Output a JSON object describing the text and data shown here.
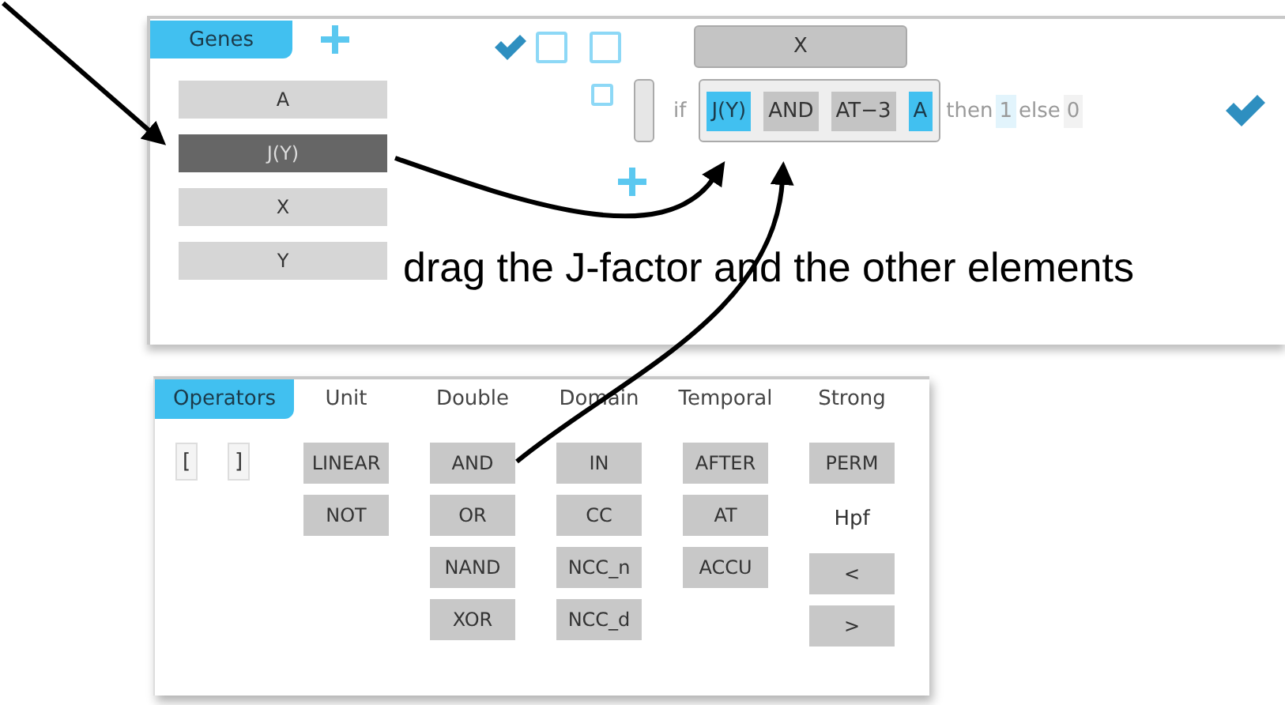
{
  "genes_panel": {
    "tab": {
      "label": "Genes",
      "selected": true
    },
    "genes": [
      {
        "label": "A",
        "selected": false
      },
      {
        "label": "J(Y)",
        "selected": true
      },
      {
        "label": "X",
        "selected": false
      },
      {
        "label": "Y",
        "selected": false
      }
    ],
    "column_checkboxes": [
      {
        "checked": false
      },
      {
        "checked": false
      }
    ],
    "rule": {
      "target": "X",
      "row_checked": false,
      "if_label": "if",
      "tokens": [
        {
          "label": "J(Y)",
          "kind": "gene"
        },
        {
          "label": "AND",
          "kind": "operator"
        },
        {
          "label": "AT−3",
          "kind": "operator"
        },
        {
          "label": "A",
          "kind": "gene"
        }
      ],
      "then_label": "then",
      "then_value": "1",
      "else_label": "else",
      "else_value": "0"
    }
  },
  "caption": "drag the J-factor and the other elements",
  "operators_panel": {
    "tab": {
      "label": "Operators",
      "selected": true
    },
    "brackets": [
      "[",
      "]"
    ],
    "columns": [
      {
        "header": "Unit",
        "items": [
          {
            "label": "LINEAR",
            "kind": "button"
          },
          {
            "label": "NOT",
            "kind": "button"
          }
        ]
      },
      {
        "header": "Double",
        "items": [
          {
            "label": "AND",
            "kind": "button"
          },
          {
            "label": "OR",
            "kind": "button"
          },
          {
            "label": "NAND",
            "kind": "button"
          },
          {
            "label": "XOR",
            "kind": "button"
          }
        ]
      },
      {
        "header": "Domain",
        "items": [
          {
            "label": "IN",
            "kind": "button"
          },
          {
            "label": "CC",
            "kind": "button"
          },
          {
            "label": "NCC_n",
            "kind": "button"
          },
          {
            "label": "NCC_d",
            "kind": "button"
          }
        ]
      },
      {
        "header": "Temporal",
        "items": [
          {
            "label": "AFTER",
            "kind": "button"
          },
          {
            "label": "AT",
            "kind": "button"
          },
          {
            "label": "ACCU",
            "kind": "button"
          }
        ]
      },
      {
        "header": "Strong",
        "items": [
          {
            "label": "PERM",
            "kind": "button"
          },
          {
            "label": "Hpf",
            "kind": "text"
          },
          {
            "label": "<",
            "kind": "button"
          },
          {
            "label": ">",
            "kind": "button"
          }
        ]
      }
    ]
  }
}
